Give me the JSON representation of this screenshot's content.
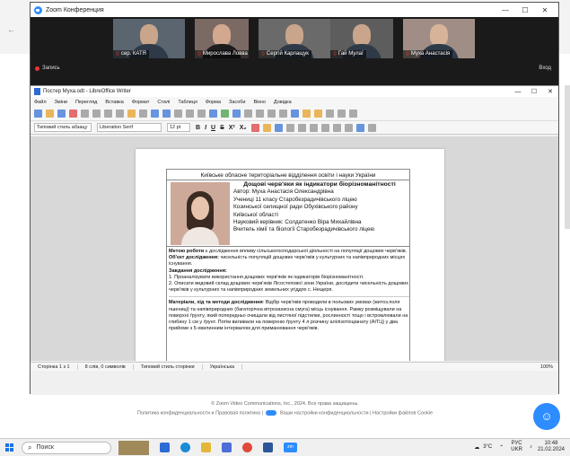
{
  "zoom": {
    "window_title": "Zoom Конференция",
    "controls": [
      "—",
      "☐",
      "✕"
    ],
    "participants": [
      {
        "label": "сер. КАТЯ"
      },
      {
        "label": "Мирослава Ловва"
      },
      {
        "label": "Сергій Карлащук"
      },
      {
        "label": "Гай Мулаї"
      },
      {
        "label": "Муха Анастасія"
      }
    ],
    "record_label": "Запись",
    "exit_label": "Вход"
  },
  "writer": {
    "title": "Постер Муха.odt - LibreOffice Writer",
    "controls": [
      "—",
      "☐",
      "✕"
    ],
    "menu": [
      "Файл",
      "Зміни",
      "Перегляд",
      "Вставка",
      "Формат",
      "Стилі",
      "Таблиця",
      "Форма",
      "Засоби",
      "Вікно",
      "Довідка"
    ],
    "paragraph_style": "Типовий стиль абзацу",
    "font_name": "Liberation Serif",
    "font_size": "12 pt",
    "fmt_buttons": [
      "B",
      "I",
      "U",
      "S",
      "X²",
      "X₂"
    ],
    "status": {
      "page": "Сторінка 1 з 1",
      "words": "8 слів, 0 символів",
      "style": "Типовий стиль сторінки",
      "language": "Українська",
      "zoom": "100%"
    }
  },
  "poster": {
    "header": "Київське обласне територіальне відділення освіти і науки України",
    "title": "Дощові черв'яки як індикатори біорізноманітності",
    "info": [
      "Автор: Муха Анастасія Олександрівна",
      "Учениці 11 класу Старобезрадичівського ліцею",
      "Козинської селищної ради Обухівського району",
      "Київської області",
      "Науковий керівник:    Солдатенко Віра Михайлівна",
      "Вчитель хімії та біології Старобезрадичівського ліцею"
    ],
    "goal_label": "Метою роботи",
    "goal_text": " є дослідження впливу сільськогосподарської діяльності на популяції дощових черв'яків.",
    "object_label": "Об'єкт дослідження:",
    "object_text": " чисельність популяцій дощових черв'яків у культурних та напівприродних місцях існування.",
    "tasks_label": "Завдання дослідження:",
    "tasks": [
      "1. Проаналізувати використання дощових черв'яків як індикаторів біорізноманітності.",
      "2. Описати видовий склад дощових черв'яків Лісостепової зони України, дослідити чисельність дощових черв'яків у культурних та напівприродних земельних угіддях с. Нещеря."
    ],
    "methods_label": "Матеріали, хід та методи дослідження",
    "methods_text": ": Відбір черв'яків проводили в польових умовах (житоз.поля пшениці) та напівприродних (багаторічна вітрозахисна смуга) місць існування. Рамку розміщували на поверхні ґрунту, який попередньо очищали від листяної підстилки, рослинності тощо і встромлювали на глибину 1 см у ґрунт. Потім виливали на поверхню ґрунту 4 л розчину алілізотіоціанату (АІТЦ) у два прийоми з 5-хвилинним інтервалом для приманювання черв'яків."
  },
  "footer": {
    "copyright": "© Zoom Video Communications, Inc., 2024. Все права защищены.",
    "privacy_policy": "Политика конфиденциальности и Правовая политика",
    "privacy_settings": "Ваши настройки конфиденциальности",
    "cookie_settings": "Настройки файлов Cookie"
  },
  "taskbar": {
    "search_label": "Поиск",
    "zoom_app": "zm",
    "weather": "3°C",
    "lang_top": "РУС",
    "lang_bottom": "UKR",
    "time": "10:48",
    "date": "21.02.2024"
  }
}
